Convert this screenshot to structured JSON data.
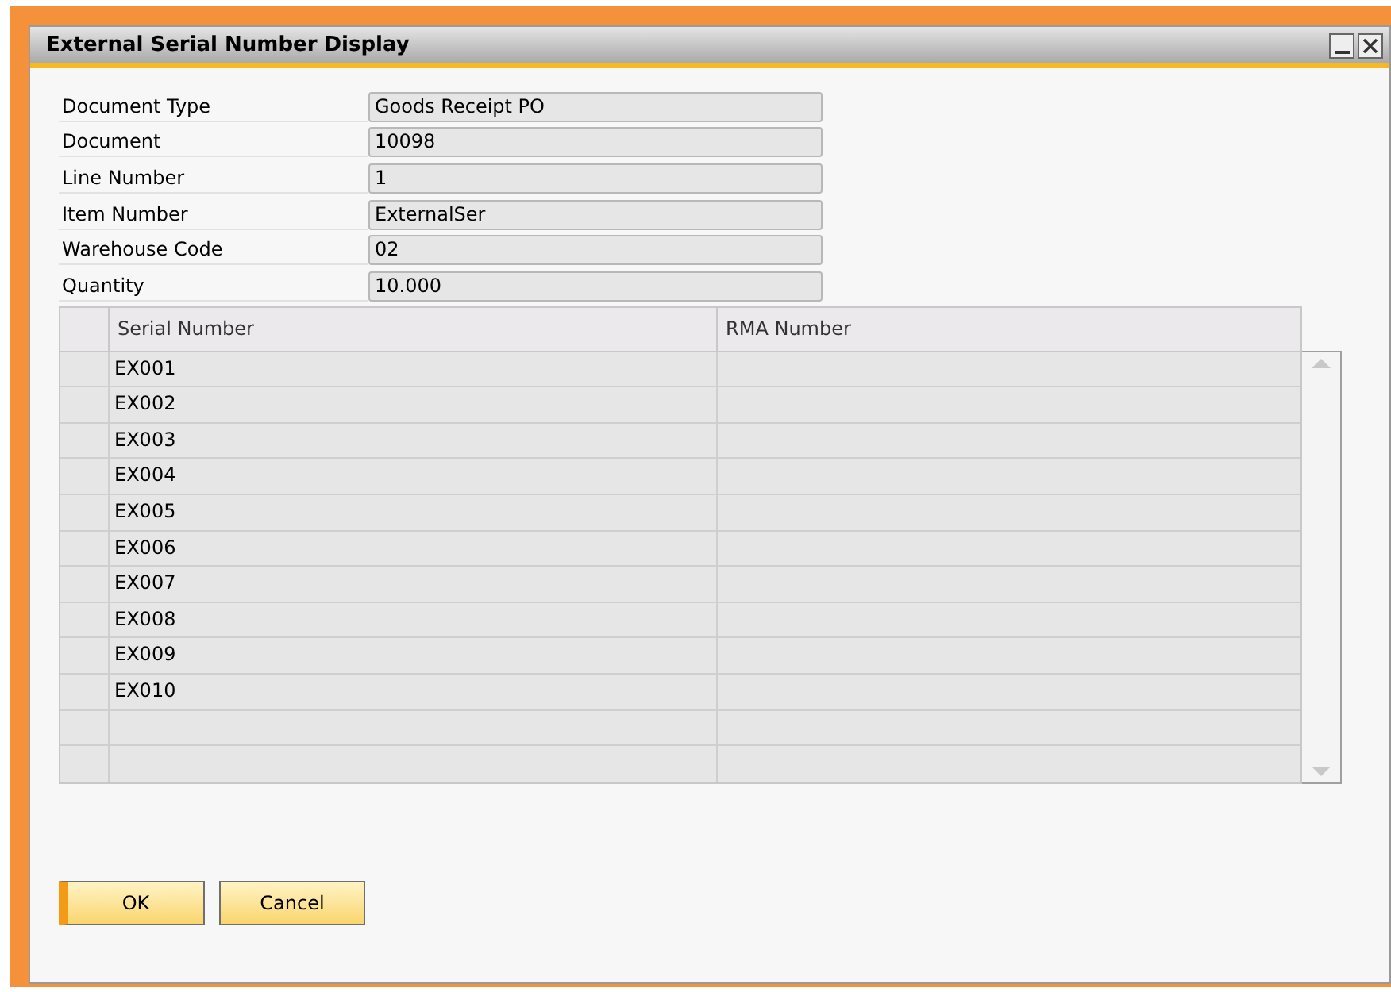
{
  "window": {
    "title": "External Serial Number Display"
  },
  "fields": [
    {
      "label": "Document Type",
      "value": "Goods Receipt PO"
    },
    {
      "label": "Document",
      "value": "10098"
    },
    {
      "label": "Line Number",
      "value": "1"
    },
    {
      "label": "Item Number",
      "value": "ExternalSer"
    },
    {
      "label": "Warehouse Code",
      "value": "02"
    },
    {
      "label": "Quantity",
      "value": "10.000"
    }
  ],
  "table": {
    "columns": [
      "Serial Number",
      "RMA Number"
    ],
    "rows": [
      {
        "serial_number": "EX001"
      },
      {
        "serial_number": "EX002"
      },
      {
        "serial_number": "EX003"
      },
      {
        "serial_number": "EX004"
      },
      {
        "serial_number": "EX005"
      },
      {
        "serial_number": "EX006"
      },
      {
        "serial_number": "EX007"
      },
      {
        "serial_number": "EX008"
      },
      {
        "serial_number": "EX009"
      },
      {
        "serial_number": "EX010"
      }
    ]
  },
  "buttons": [
    {
      "label": "OK",
      "default": true
    },
    {
      "label": "Cancel",
      "default": false
    }
  ]
}
